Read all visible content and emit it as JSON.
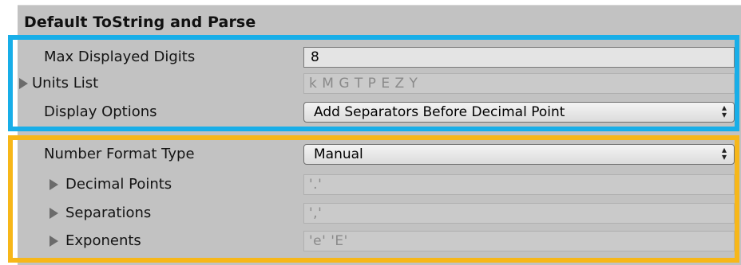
{
  "section": {
    "title": "Default ToString and Parse"
  },
  "rows": {
    "max_digits": {
      "label": "Max Displayed Digits",
      "value": "8"
    },
    "units_list": {
      "label": "Units List",
      "value": "k M G T P E Z Y"
    },
    "display_options": {
      "label": "Display Options",
      "value": "Add Separators Before Decimal Point"
    },
    "number_format_type": {
      "label": "Number Format Type",
      "value": "Manual"
    },
    "decimal_points": {
      "label": "Decimal Points",
      "value": "'.'"
    },
    "separations": {
      "label": "Separations",
      "value": "','"
    },
    "exponents": {
      "label": "Exponents",
      "value": "'e' 'E'"
    }
  },
  "icons": {
    "foldout": "foldout-triangle-icon",
    "popup": "popup-arrows-icon"
  },
  "colors": {
    "panel_bg": "#c2c2c2",
    "highlight_blue": "#18aee8",
    "highlight_yellow": "#f7b719"
  }
}
